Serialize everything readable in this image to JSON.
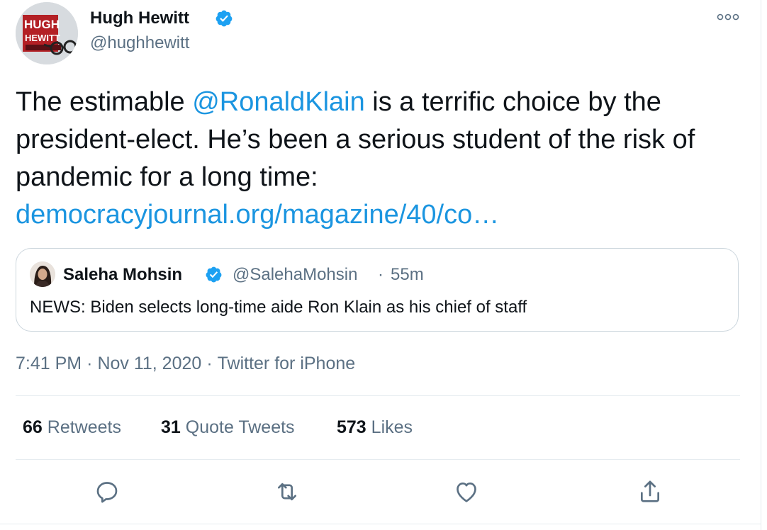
{
  "author": {
    "name": "Hugh Hewitt",
    "handle": "@hughhewitt",
    "avatar_logo_text": [
      "HUGH",
      "HEWITT"
    ],
    "verified": true
  },
  "tweet": {
    "text_before": "The estimable ",
    "mention": "@RonaldKlain",
    "text_after": " is a terrific choice by the president-elect. He’s been a serious student of the risk of pandemic for a long time:",
    "link": "democracyjournal.org/magazine/40/co…"
  },
  "quoted_tweet": {
    "name": "Saleha Mohsin",
    "handle": "@SalehaMohsin",
    "separator": "·",
    "time": "55m",
    "text": "NEWS: Biden selects long-time aide Ron Klain as his chief of staff",
    "verified": true
  },
  "meta": {
    "time": "7:41 PM",
    "date": "Nov 11, 2020",
    "source": "Twitter for iPhone",
    "separator": "·"
  },
  "stats": {
    "retweets_count": "66",
    "retweets_label": "Retweets",
    "quotes_count": "31",
    "quotes_label": "Quote Tweets",
    "likes_count": "573",
    "likes_label": "Likes"
  },
  "icons": {
    "verified": "verified-badge-icon",
    "more": "more-options-icon",
    "reply": "reply-icon",
    "retweet": "retweet-icon",
    "like": "like-icon",
    "share": "share-icon"
  },
  "colors": {
    "accent": "#1b95e0",
    "secondary_text": "#5b7083",
    "border": "#ccd6dd",
    "icon": "#5b7083"
  }
}
